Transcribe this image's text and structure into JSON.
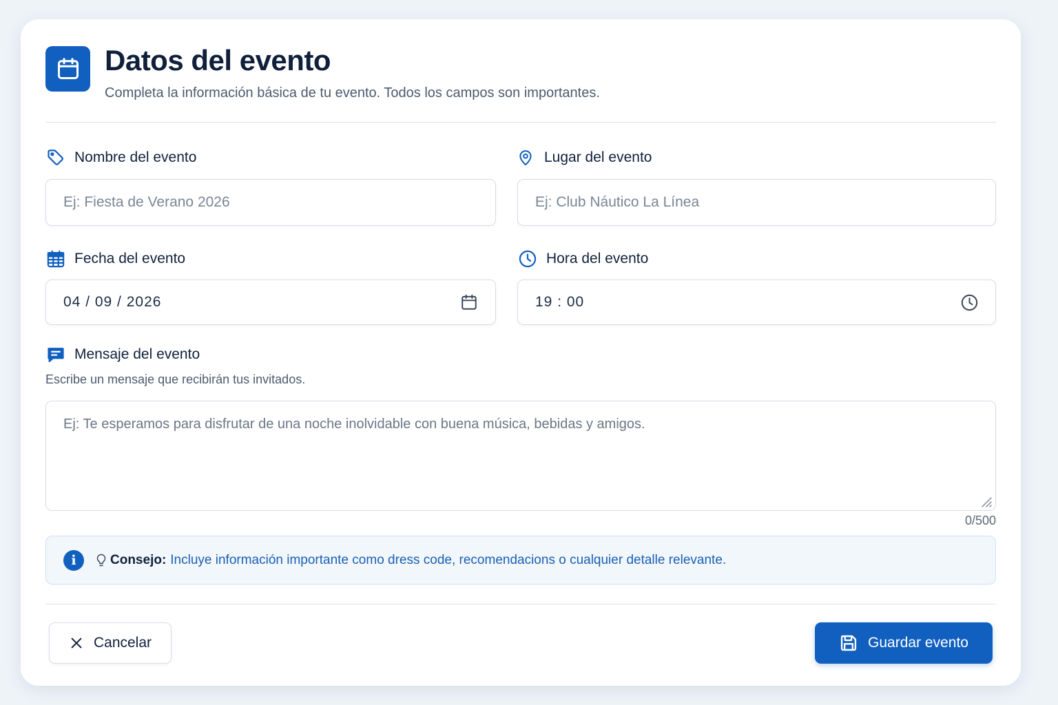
{
  "header": {
    "title": "Datos del evento",
    "subtitle": "Completa la información básica de tu evento. Todos los campos son importantes.",
    "icon": "calendar-icon"
  },
  "fields": {
    "name": {
      "label": "Nombre del evento",
      "placeholder": "Ej: Fiesta de Verano 2026",
      "value": "",
      "icon": "tag-icon"
    },
    "place": {
      "label": "Lugar del evento",
      "placeholder": "Ej: Club Náutico La Línea",
      "value": "",
      "icon": "map-pin-icon"
    },
    "date": {
      "label": "Fecha del evento",
      "value": "04 / 09 / 2026",
      "icon": "calendar-grid-icon",
      "trailing_icon": "calendar-icon"
    },
    "time": {
      "label": "Hora del evento",
      "value": "19 : 00",
      "icon": "clock-icon",
      "trailing_icon": "clock-icon"
    }
  },
  "message": {
    "label": "Mensaje del evento",
    "helper": "Escribe un mensaje que recibirán tus invitados.",
    "placeholder": "Ej: Te esperamos para disfrutar de una noche inolvidable con buena música, bebidas y amigos.",
    "counter": "0/500",
    "icon": "chat-icon"
  },
  "tip": {
    "label": "Consejo:",
    "text": "Incluye información importante como dress code, recomendacions o cualquier detalle relevante.",
    "icon": "info-icon",
    "bulb_icon": "lightbulb-icon"
  },
  "actions": {
    "cancel_label": "Cancelar",
    "save_label": "Guardar evento"
  },
  "colors": {
    "accent": "#1160c0",
    "text": "#10203b",
    "muted": "#4b5a6e",
    "tip_bg": "#f2f7fc"
  }
}
